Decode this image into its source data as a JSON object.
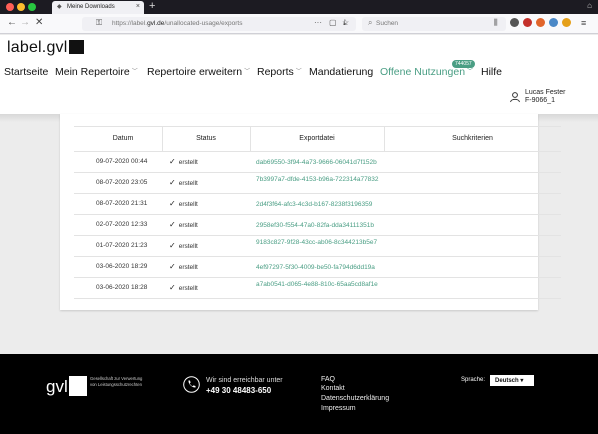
{
  "browser": {
    "tab_title": "Meine Downloads",
    "url_prefix": "https://label.",
    "url_domain": "gvl.de",
    "url_path": "/unallocated-usage/exports",
    "search_placeholder": "Suchen"
  },
  "header": {
    "logo": "label.gvl",
    "nav": [
      {
        "label": "Startseite"
      },
      {
        "label": "Mein Repertoire"
      },
      {
        "label": "Repertoire erweitern"
      },
      {
        "label": "Reports"
      },
      {
        "label": "Mandatierung"
      },
      {
        "label": "Offene Nutzungen"
      },
      {
        "label": "Hilfe"
      }
    ],
    "badge": "744057",
    "user_name": "Lucas Fester",
    "user_id": "F-9066_1"
  },
  "table": {
    "headers": [
      "Datum",
      "Status",
      "Exportdatei",
      "Suchkriterien"
    ],
    "rows": [
      {
        "date": "09-07-2020 00:44",
        "status": "erstellt",
        "file": "dab69550-3f94-4a73-9666-06041d7f152b"
      },
      {
        "date": "08-07-2020 23:05",
        "status": "erstellt",
        "file": "7b3997a7-dfde-4153-b96a-722314a77832"
      },
      {
        "date": "08-07-2020 21:31",
        "status": "erstellt",
        "file": "2d4f3f64-afc3-4c3d-b167-8238f3196359"
      },
      {
        "date": "02-07-2020 12:33",
        "status": "erstellt",
        "file": "2958ef30-f554-47a0-82fa-dda34111351b"
      },
      {
        "date": "01-07-2020 21:23",
        "status": "erstellt",
        "file": "9183c827-9f28-43cc-ab06-8c344213b5e7"
      },
      {
        "date": "03-06-2020 18:29",
        "status": "erstellt",
        "file": "4ef97297-5f30-4009-be50-fa794d6dd19a"
      },
      {
        "date": "03-06-2020 18:28",
        "status": "erstellt",
        "file": "a7ab0541-d065-4e88-810c-65aa5cd8af1e"
      }
    ]
  },
  "footer": {
    "logo": "gvl",
    "tagline": "Gesellschaft zur Verwertung von Leistungsschutzrechten",
    "contact_label": "Wir sind erreichbar unter",
    "contact_number": "+49 30 48483-650",
    "links": [
      "FAQ",
      "Kontakt",
      "Datenschutzerklärung",
      "Impressum"
    ],
    "language_label": "Sprache:",
    "language_value": "Deutsch"
  },
  "colors": {
    "accent": "#4a9e84",
    "footer_bg": "#000000"
  }
}
